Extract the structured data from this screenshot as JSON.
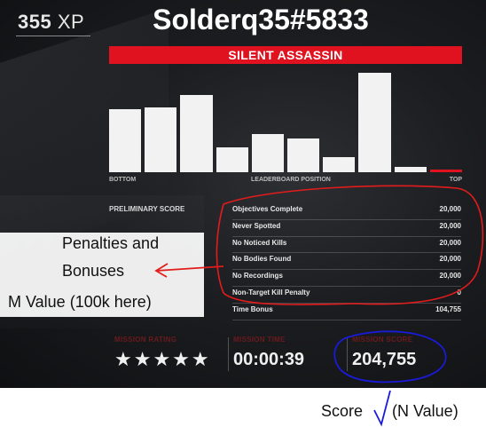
{
  "hud": {
    "xp_value": "355",
    "xp_unit": "XP"
  },
  "header": {
    "player_name": "Solderq35#5833",
    "rating_title": "SILENT ASSASSIN"
  },
  "leaderboard": {
    "bottom_label": "BOTTOM",
    "center_label": "LEADERBOARD POSITION",
    "top_label": "TOP",
    "bars": [
      0.63,
      0.65,
      0.78,
      0.25,
      0.38,
      0.34,
      0.15,
      1.0,
      0.05,
      0.02
    ],
    "highlight_index": 9
  },
  "score_breakdown": {
    "section_label": "PRELIMINARY SCORE",
    "rows": [
      {
        "label": "Objectives Complete",
        "value": "20,000"
      },
      {
        "label": "Never Spotted",
        "value": "20,000"
      },
      {
        "label": "No Noticed Kills",
        "value": "20,000"
      },
      {
        "label": "No Bodies Found",
        "value": "20,000"
      },
      {
        "label": "No Recordings",
        "value": "20,000"
      },
      {
        "label": "Non-Target Kill Penalty",
        "value": "0"
      },
      {
        "label": "Time Bonus",
        "value": "104,755"
      }
    ]
  },
  "mission_stats": {
    "rating_label": "MISSION RATING",
    "rating_stars": "★★★★★",
    "time_label": "MISSION TIME",
    "time_value": "00:00:39",
    "score_label": "MISSION SCORE",
    "score_value": "204,755"
  },
  "annotations": {
    "penalties_line1": "Penalties and",
    "penalties_line2": "Bonuses",
    "m_value": "M Value (100k here)",
    "score_word": "Score",
    "n_value": "(N Value)"
  },
  "colors": {
    "accent_red": "#e0121f",
    "annotation_red": "#e21c1c",
    "annotation_blue": "#1a1adb"
  }
}
